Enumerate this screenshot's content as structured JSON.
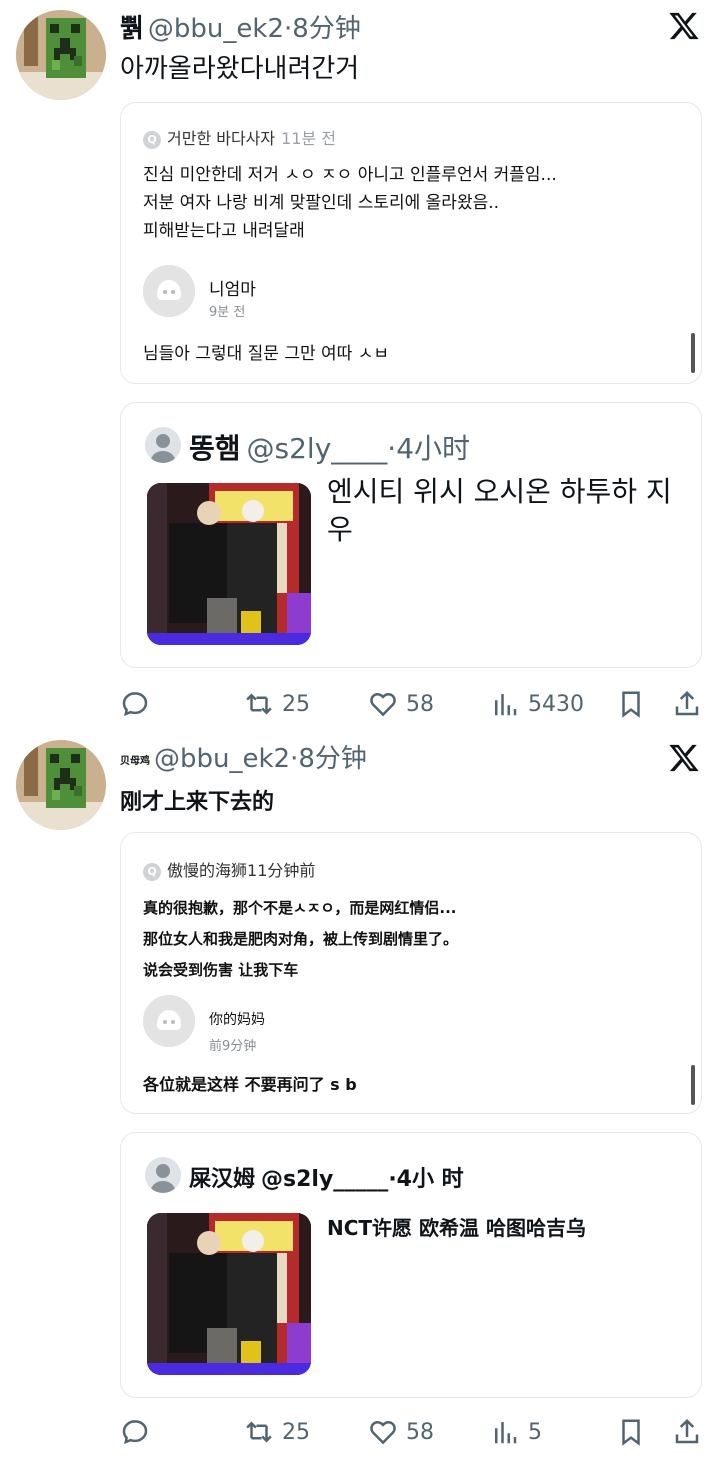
{
  "posts": [
    {
      "display_name": "뿱",
      "handle": "@bbu_ek2",
      "time": "·8分钟",
      "text": "아까올라왔다내려간거",
      "quote_card": {
        "asker": "거만한 바다사자",
        "ask_time": "11분 전",
        "question_lines": [
          "진심 미안한데 저거 ㅅㅇ ㅈㅇ 아니고 인플루언서 커플임...",
          "저분 여자 나랑 비계 맞팔인데 스토리에 올라왔음..",
          "피해받는다고 내려달래"
        ],
        "answerer": "니엄마",
        "answer_time": "9분 전",
        "answer": "님들아 그렇대 질문 그만 여따 ㅅㅂ"
      },
      "quoted_tweet": {
        "name": "똥햄",
        "handle": "@s2ly____",
        "time": "·4小时",
        "text": "엔시티 위시 오시온 하투하 지우"
      },
      "stats": {
        "replies": "",
        "retweets": "25",
        "likes": "58",
        "views": "5430"
      }
    },
    {
      "display_name": "贝母鸡",
      "handle": "@bbu_ek2",
      "time": "·8分钟",
      "text": "刚才上来下去的",
      "quote_card": {
        "asker": "傲慢的海狮",
        "ask_time": "11分钟前",
        "question_lines": [
          "真的很抱歉，那个不是ㅅㅈㅇ，而是网红情侣...",
          "那位女人和我是肥肉对角，被上传到剧情里了。",
          "说会受到伤害 让我下车"
        ],
        "answerer": "你的妈妈",
        "answer_time": "前9分钟",
        "answer": "各位就是这样 不要再问了 s b"
      },
      "quoted_tweet": {
        "name": "屎汉姆",
        "handle": "@s2ly_____",
        "time": "·4小 时",
        "text": "NCT许愿 欧希温 哈图哈吉乌"
      },
      "stats": {
        "replies": "",
        "retweets": "25",
        "likes": "58",
        "views": "5"
      }
    }
  ],
  "icons": {
    "x_logo": "x-logo-icon",
    "reply": "reply-icon",
    "retweet": "retweet-icon",
    "like": "heart-icon",
    "views": "views-icon",
    "bookmark": "bookmark-icon",
    "share": "share-icon"
  },
  "colors": {
    "text": "#0f1419",
    "muted": "#536471",
    "border": "#e5e8eb"
  }
}
